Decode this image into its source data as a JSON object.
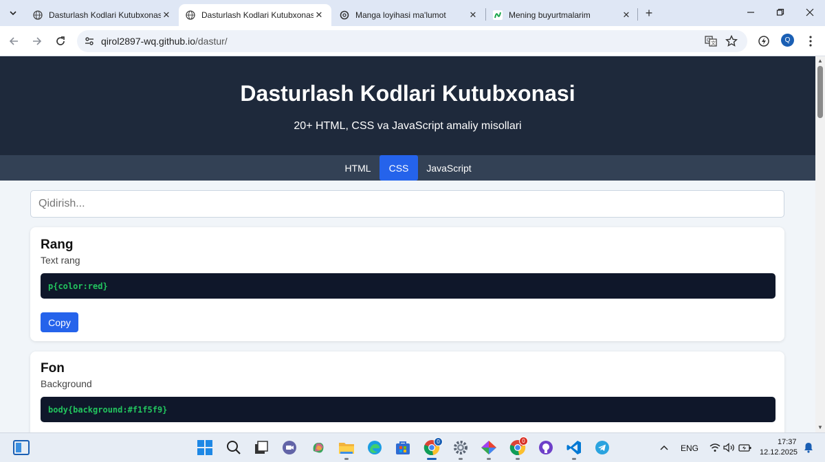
{
  "browser": {
    "tabs": [
      {
        "title": "Dasturlash Kodlari Kutubxonasi",
        "favicon": "globe-icon",
        "active": false
      },
      {
        "title": "Dasturlash Kodlari Kutubxonasi",
        "favicon": "globe-icon",
        "active": true
      },
      {
        "title": "Manga loyihasi ma'lumot",
        "favicon": "openai-icon",
        "active": false
      },
      {
        "title": "Mening buyurtmalarim",
        "favicon": "uzum-icon",
        "active": false
      }
    ],
    "url_host": "qirol2897-wq.github.io",
    "url_path": "/dastur/",
    "profile_initial": "Q"
  },
  "page": {
    "title": "Dasturlash Kodlari Kutubxonasi",
    "subtitle": "20+ HTML, CSS va JavaScript amaliy misollari",
    "categories": [
      {
        "label": "HTML",
        "active": false
      },
      {
        "label": "CSS",
        "active": true
      },
      {
        "label": "JavaScript",
        "active": false
      }
    ],
    "search_placeholder": "Qidirish...",
    "cards": [
      {
        "title": "Rang",
        "description": "Text rang",
        "code": "p{color:red}",
        "button": "Copy"
      },
      {
        "title": "Fon",
        "description": "Background",
        "code": "body{background:#f1f5f9}"
      }
    ]
  },
  "taskbar": {
    "chrome_badge": "0",
    "chrome2_badge": "0",
    "language": "ENG",
    "time": "17:37",
    "date": "12.12.2025"
  },
  "colors": {
    "header_bg": "#1e293b",
    "nav_bg": "#334155",
    "accent": "#2563eb",
    "code_bg": "#0f172a",
    "code_text": "#22c55e"
  }
}
